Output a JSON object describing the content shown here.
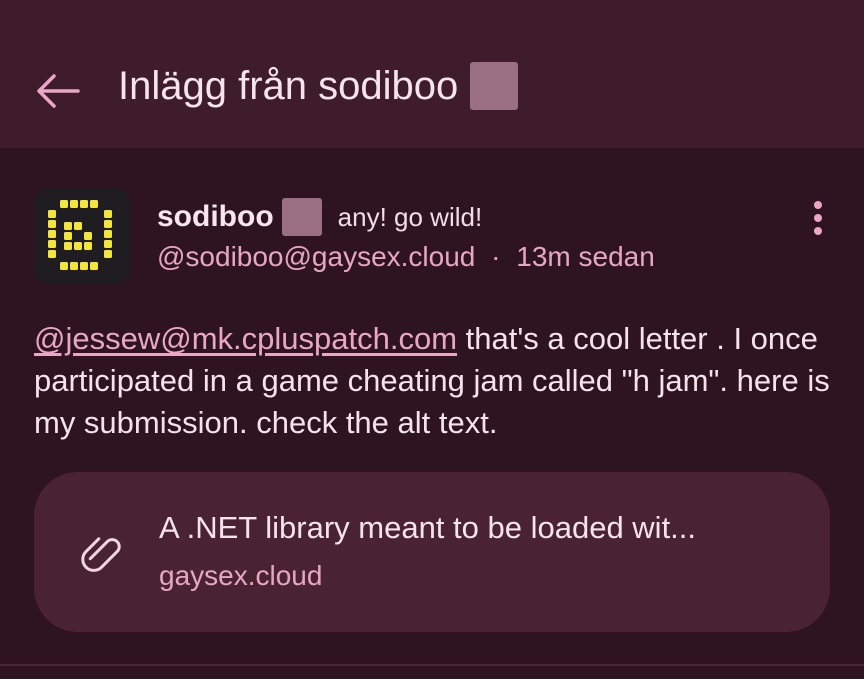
{
  "header": {
    "title": "Inlägg från sodiboo",
    "back_icon": "arrow-left-icon"
  },
  "post": {
    "author": {
      "name": "sodiboo",
      "status": "any! go wild!",
      "handle": "@sodiboo@gaysex.cloud",
      "separator": "·",
      "time": "13m sedan"
    },
    "more_icon": "more-vertical-icon",
    "body": {
      "mention": "@jessew@mk.cpluspatch.com",
      "text": " that's a cool letter . I once participated in a game cheating jam called \"h jam\". here is my submission. check the alt text."
    },
    "link_card": {
      "icon": "paperclip-icon",
      "title": "A .NET library meant to be loaded wit...",
      "domain": "gaysex.cloud"
    }
  },
  "colors": {
    "background": "#2e1420",
    "topbar": "#3f1c2b",
    "card": "#4a2332",
    "accent": "#e6a6c4",
    "emoji_placeholder": "#9b6f83",
    "avatar_yellow": "#f2e63a"
  }
}
